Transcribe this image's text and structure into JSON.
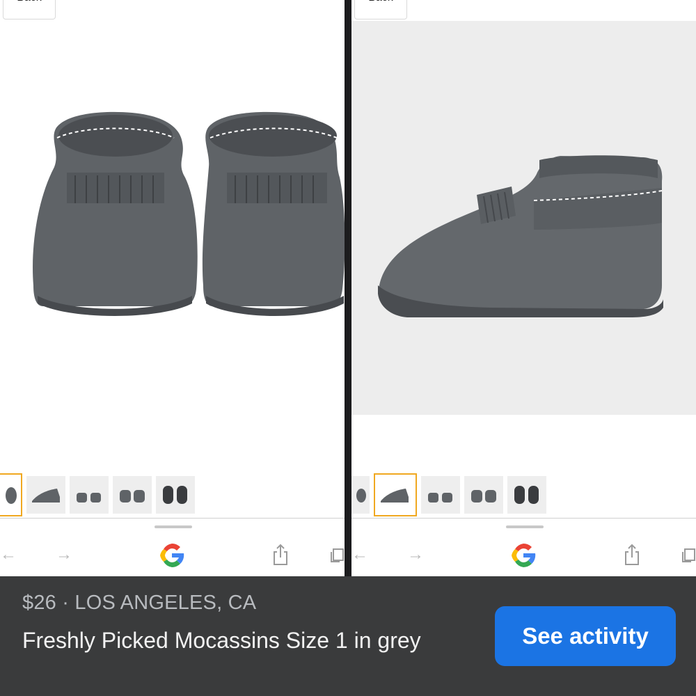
{
  "left_panel": {
    "back_label": "Back",
    "browser": {
      "back_icon": "arrow-left-icon",
      "forward_icon": "arrow-right-icon",
      "logo_icon": "google-g-icon",
      "share_icon": "share-icon",
      "tabs_icon": "tabs-icon"
    }
  },
  "right_panel": {
    "back_label": "Back"
  },
  "listing": {
    "price": "$26",
    "separator": "·",
    "location": "LOS ANGELES, CA",
    "title": "Freshly Picked Mocassins Size 1 in grey",
    "cta_label": "See activity"
  },
  "colors": {
    "cta": "#1b74e4",
    "bottom_bar": "#3a3b3c",
    "selected_thumb_border": "#f0a820",
    "shoe_grey": "#5e6266"
  }
}
